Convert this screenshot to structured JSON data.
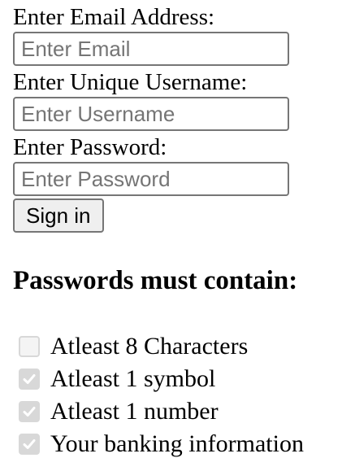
{
  "form": {
    "email_label": "Enter Email Address:",
    "email_placeholder": "Enter Email",
    "email_value": "",
    "username_label": "Enter Unique Username:",
    "username_placeholder": "Enter Username",
    "username_value": "",
    "password_label": "Enter Password:",
    "password_placeholder": "Enter Password",
    "password_value": "",
    "signin_label": "Sign in"
  },
  "requirements": {
    "heading": "Passwords must contain:",
    "items": [
      {
        "label": "Atleast 8 Characters",
        "checked": false,
        "icon": "checkbox-empty-icon"
      },
      {
        "label": "Atleast 1 symbol",
        "checked": true,
        "icon": "checkbox-checked-icon"
      },
      {
        "label": "Atleast 1 number",
        "checked": true,
        "icon": "checkbox-checked-icon"
      },
      {
        "label": "Your banking information",
        "checked": true,
        "icon": "checkbox-checked-icon"
      }
    ],
    "checkbox_color": "#d8d8d8",
    "checkmark_color": "#ffffff"
  }
}
